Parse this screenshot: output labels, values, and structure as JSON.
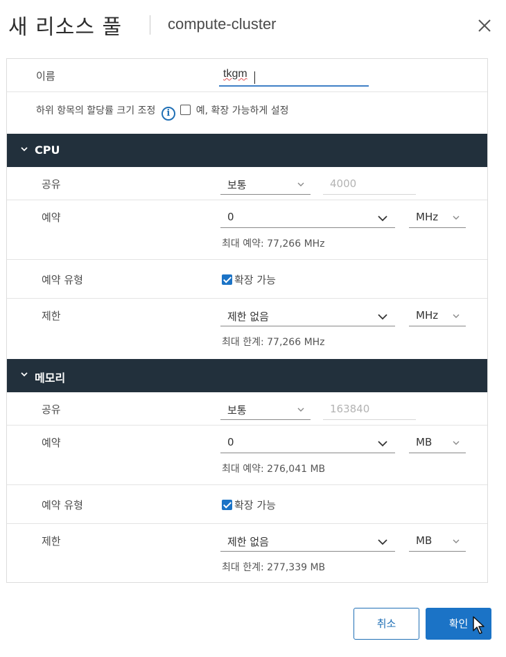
{
  "dialog": {
    "title": "새 리소스 풀",
    "subtitle": "compute-cluster"
  },
  "name_row": {
    "label": "이름",
    "value": "tkgm"
  },
  "scale_row": {
    "label": "하위 항목의 할당률 크기 조정",
    "checkbox_label": "예, 확장 가능하게 설정",
    "checked": false
  },
  "cpu": {
    "header": "CPU",
    "shares": {
      "label": "공유",
      "level": "보통",
      "value": "4000"
    },
    "reservation": {
      "label": "예약",
      "value": "0",
      "unit": "MHz",
      "hint": "최대 예약: 77,266 MHz"
    },
    "reservation_type": {
      "label": "예약 유형",
      "checkbox_label": "확장 가능",
      "checked": true
    },
    "limit": {
      "label": "제한",
      "value": "제한 없음",
      "unit": "MHz",
      "hint": "최대 한계: 77,266 MHz"
    }
  },
  "memory": {
    "header": "메모리",
    "shares": {
      "label": "공유",
      "level": "보통",
      "value": "163840"
    },
    "reservation": {
      "label": "예약",
      "value": "0",
      "unit": "MB",
      "hint": "최대 예약: 276,041 MB"
    },
    "reservation_type": {
      "label": "예약 유형",
      "checkbox_label": "확장 가능",
      "checked": true
    },
    "limit": {
      "label": "제한",
      "value": "제한 없음",
      "unit": "MB",
      "hint": "최대 한계: 277,339 MB"
    }
  },
  "footer": {
    "cancel_label": "취소",
    "ok_label": "확인"
  },
  "colors": {
    "section_header": "#22303c",
    "primary": "#1b73c6",
    "input_focus": "#3f7fc6"
  }
}
